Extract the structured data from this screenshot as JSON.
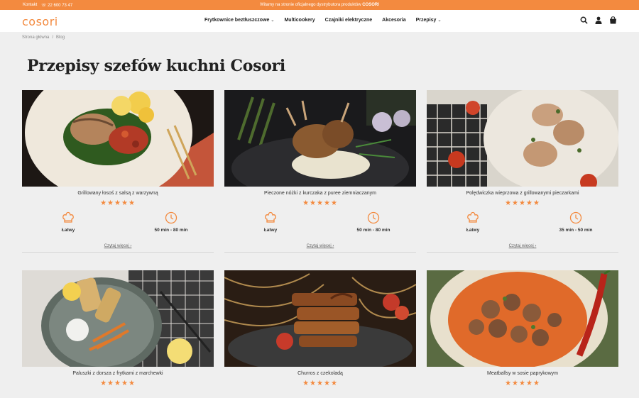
{
  "topbar": {
    "contact": "Kontakt",
    "phone": "22 600 73 47",
    "welcome_text": "Witamy na stronie oficjalnego dystrybutora produktów",
    "welcome_brand": "COSORI"
  },
  "header": {
    "logo": "cosori",
    "nav": [
      {
        "label": "Frytkownice beztłuszczowe",
        "has_dropdown": true
      },
      {
        "label": "Multicookery",
        "has_dropdown": false
      },
      {
        "label": "Czajniki elektryczne",
        "has_dropdown": false
      },
      {
        "label": "Akcesoria",
        "has_dropdown": false
      },
      {
        "label": "Przepisy",
        "has_dropdown": true
      }
    ],
    "icons": [
      "search-icon",
      "user-icon",
      "cart-icon"
    ]
  },
  "breadcrumb": {
    "home": "Strona główna",
    "current": "Blog"
  },
  "page_title": "Przepisy szefów kuchni Cosori",
  "colors": {
    "accent": "#f38a3f",
    "background": "#efefef"
  },
  "recipes": [
    {
      "title": "Grillowany łosoś z salsą z warzywną",
      "stars": "★★★★★",
      "difficulty": "Łatwy",
      "time": "50 min - 80 min",
      "more": "Czytaj więcej ›"
    },
    {
      "title": "Pieczone nóżki z kurczaka z puree ziemniaczanym",
      "stars": "★★★★★",
      "difficulty": "Łatwy",
      "time": "50 min - 80 min",
      "more": "Czytaj więcej ›"
    },
    {
      "title": "Polędwiczka wieprzowa z grillowanymi pieczarkami",
      "stars": "★★★★★",
      "difficulty": "Łatwy",
      "time": "35 min - 50 min",
      "more": "Czytaj więcej ›"
    },
    {
      "title": "Paluszki z dorsza z frytkami z marchewki",
      "stars": "★★★★★"
    },
    {
      "title": "Churros z czekoladą",
      "stars": "★★★★★"
    },
    {
      "title": "Meatballsy w sosie paprykowym",
      "stars": "★★★★★"
    }
  ]
}
